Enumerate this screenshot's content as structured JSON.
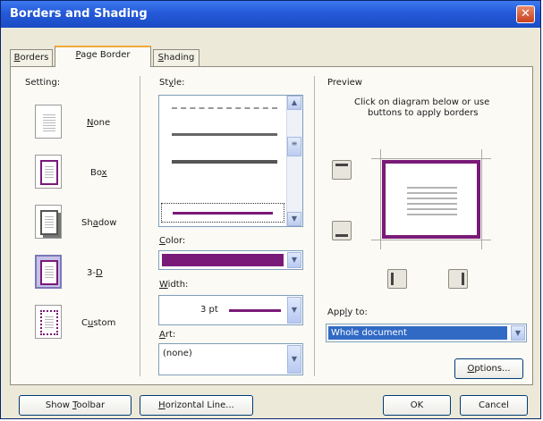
{
  "dialog": {
    "title": "Borders and Shading",
    "close_glyph": "✕"
  },
  "tabs": [
    {
      "pre": "",
      "ul": "B",
      "post": "orders"
    },
    {
      "pre": "",
      "ul": "P",
      "post": "age Border"
    },
    {
      "pre": "",
      "ul": "S",
      "post": "hading"
    }
  ],
  "setting": {
    "label": "Setting:",
    "options": [
      {
        "pre": "",
        "ul": "N",
        "post": "one"
      },
      {
        "pre": "Bo",
        "ul": "x",
        "post": ""
      },
      {
        "pre": "Sh",
        "ul": "a",
        "post": "dow"
      },
      {
        "pre": "3-",
        "ul": "D",
        "post": ""
      },
      {
        "pre": "C",
        "ul": "u",
        "post": "stom"
      }
    ],
    "selected": "3-D"
  },
  "style": {
    "pre": "St",
    "ul": "y",
    "post": "le:",
    "selected_index": 3
  },
  "color": {
    "pre": "",
    "ul": "C",
    "post": "olor:",
    "value": "#7a1a78"
  },
  "width": {
    "pre": "",
    "ul": "W",
    "post": "idth:",
    "value": "3 pt"
  },
  "art": {
    "pre": "",
    "ul": "A",
    "post": "rt:",
    "value": "(none)"
  },
  "preview": {
    "label": "Preview",
    "instruction_line1": "Click on diagram below or use",
    "instruction_line2": "buttons to apply borders"
  },
  "apply_to": {
    "pre": "App",
    "ul": "l",
    "post": "y to:",
    "value": "Whole document"
  },
  "buttons": {
    "options": {
      "pre": "",
      "ul": "O",
      "post": "ptions..."
    },
    "show_toolbar": {
      "pre": "Show ",
      "ul": "T",
      "post": "oolbar"
    },
    "horizontal_line": {
      "pre": "",
      "ul": "H",
      "post": "orizontal Line..."
    },
    "ok": "OK",
    "cancel": "Cancel"
  }
}
